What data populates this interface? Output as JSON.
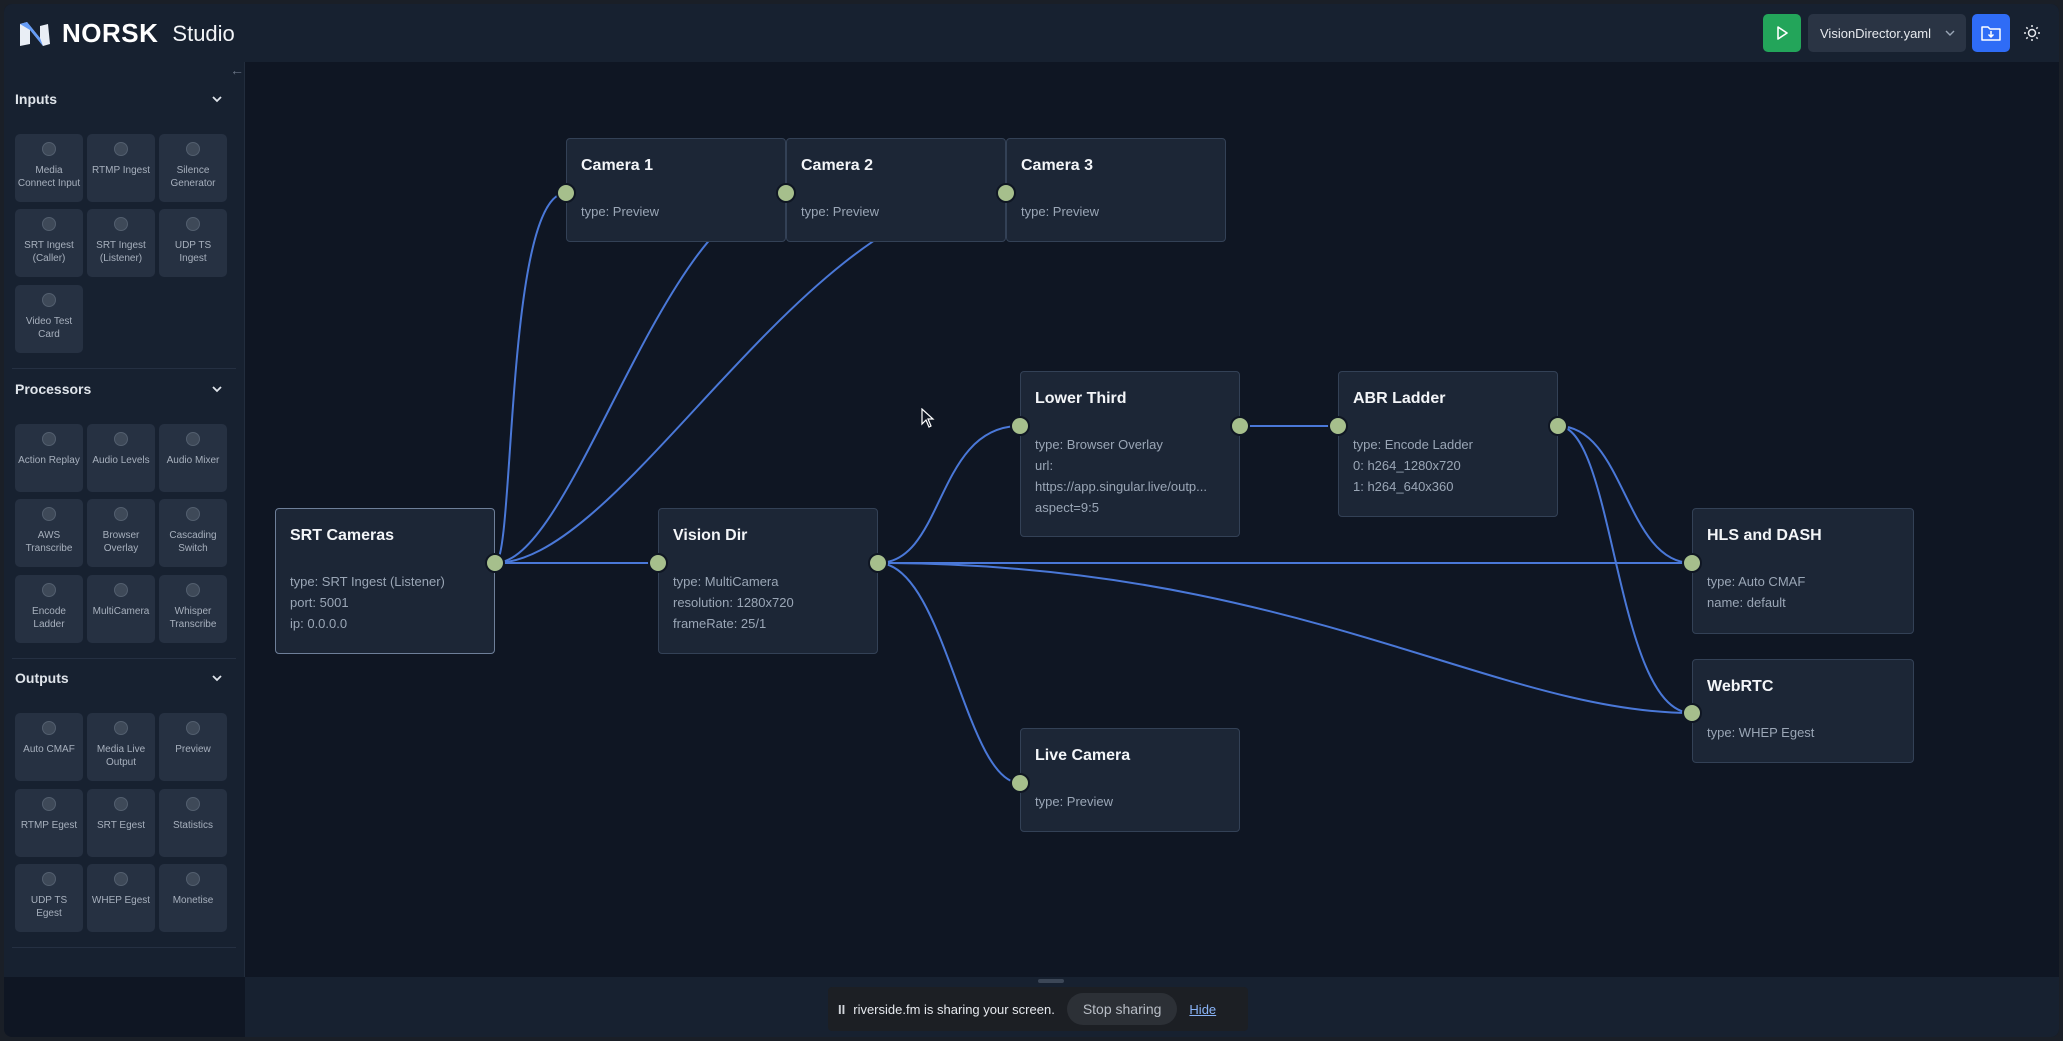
{
  "app": {
    "brand": "NORSK",
    "product": "Studio"
  },
  "toolbar": {
    "file_name": "VisionDirector.yaml"
  },
  "colors": {
    "accent_green": "#23a55a",
    "accent_blue": "#2f6cf6",
    "handle": "#a6bf8c",
    "edge": "#4a78d8"
  },
  "sidebar": {
    "collapse_icon": "←",
    "sections": [
      {
        "title": "Inputs",
        "items": [
          "Media Connect Input",
          "RTMP Ingest",
          "Silence Generator",
          "SRT Ingest (Caller)",
          "SRT Ingest (Listener)",
          "UDP TS Ingest",
          "Video Test Card"
        ]
      },
      {
        "title": "Processors",
        "items": [
          "Action Replay",
          "Audio Levels",
          "Audio Mixer",
          "AWS Transcribe",
          "Browser Overlay",
          "Cascading Switch",
          "Encode Ladder",
          "MultiCamera",
          "Whisper Transcribe"
        ]
      },
      {
        "title": "Outputs",
        "items": [
          "Auto CMAF",
          "Media Live Output",
          "Preview",
          "RTMP Egest",
          "SRT Egest",
          "Statistics",
          "UDP TS Egest",
          "WHEP Egest",
          "Monetise"
        ]
      }
    ]
  },
  "nodes": {
    "cam1": {
      "title": "Camera 1",
      "lines": [
        "type: Preview"
      ]
    },
    "cam2": {
      "title": "Camera 2",
      "lines": [
        "type: Preview"
      ]
    },
    "cam3": {
      "title": "Camera 3",
      "lines": [
        "type: Preview"
      ]
    },
    "srt": {
      "title": "SRT Cameras",
      "lines": [
        "type: SRT Ingest (Listener)",
        "port: 5001",
        "ip: 0.0.0.0"
      ]
    },
    "vision": {
      "title": "Vision Dir",
      "lines": [
        "type: MultiCamera",
        "resolution: 1280x720",
        "frameRate: 25/1"
      ]
    },
    "lower": {
      "title": "Lower Third",
      "lines": [
        "type: Browser Overlay",
        "url:",
        "https://app.singular.live/outp...",
        "aspect=9:5"
      ]
    },
    "abr": {
      "title": "ABR Ladder",
      "lines": [
        "type: Encode Ladder",
        "0: h264_1280x720",
        "1: h264_640x360"
      ]
    },
    "hls": {
      "title": "HLS and DASH",
      "lines": [
        "type: Auto CMAF",
        "name: default"
      ]
    },
    "webrtc": {
      "title": "WebRTC",
      "lines": [
        "type: WHEP Egest"
      ]
    },
    "live": {
      "title": "Live Camera",
      "lines": [
        "type: Preview"
      ]
    }
  },
  "share_banner": {
    "text": "riverside.fm is sharing your screen.",
    "stop_label": "Stop sharing",
    "hide_label": "Hide",
    "pause_icon": "II"
  }
}
